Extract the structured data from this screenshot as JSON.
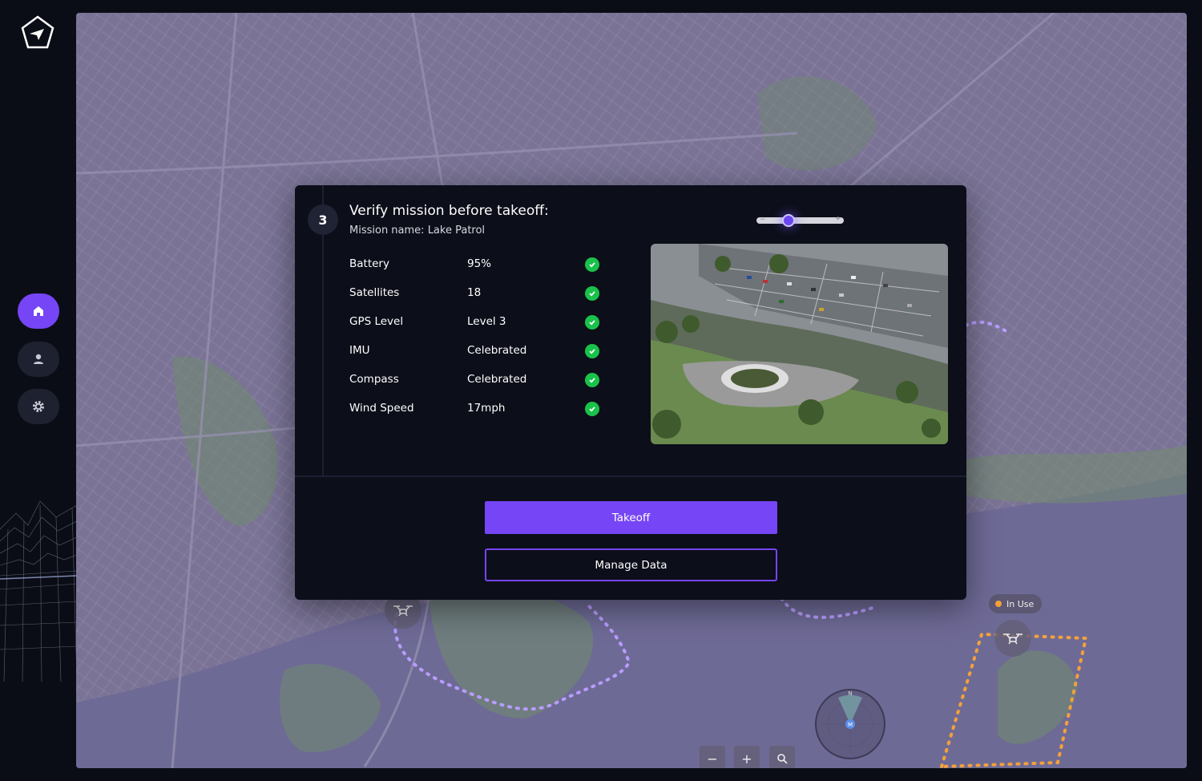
{
  "modal": {
    "step_number": "3",
    "title": "Verify mission before takeoff:",
    "subtitle": "Mission name: Lake Patrol",
    "checks": [
      {
        "label": "Battery",
        "value": "95%",
        "status": "ok"
      },
      {
        "label": "Satellites",
        "value": "18",
        "status": "ok"
      },
      {
        "label": "GPS Level",
        "value": "Level 3",
        "status": "ok"
      },
      {
        "label": "IMU",
        "value": "Celebrated",
        "status": "ok"
      },
      {
        "label": "Compass",
        "value": "Celebrated",
        "status": "ok"
      },
      {
        "label": "Wind Speed",
        "value": "17mph",
        "status": "ok"
      }
    ],
    "takeoff_label": "Takeoff",
    "manage_label": "Manage Data",
    "zoom_slider_level": 0.37
  },
  "map": {
    "drone_status": "In Use",
    "compass_north": "N",
    "compass_marker": "M",
    "zoom_out": "−",
    "zoom_in": "+"
  },
  "colors": {
    "accent": "#7645f5",
    "check_ok": "#19c24a",
    "route_purple": "#b89cff",
    "route_orange": "#f3a13a",
    "map_tint": "#7a7396"
  },
  "icons": {
    "sidebar": [
      "home-icon",
      "user-icon",
      "gear-icon"
    ],
    "map": [
      "drone-icon",
      "search-icon",
      "compass-icon"
    ]
  }
}
